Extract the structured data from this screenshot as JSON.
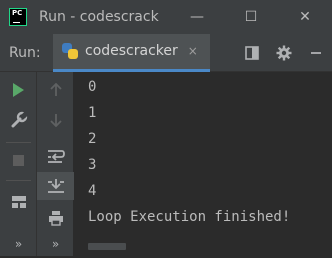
{
  "window": {
    "title": "Run - codescrack",
    "app_logo_text": "PC",
    "controls": {
      "minimize": "—",
      "maximize": "☐",
      "close": "✕"
    }
  },
  "run_toolbar": {
    "label": "Run:",
    "tab_label": "codescracker",
    "tab_close": "×",
    "settings_icon": "gear-icon",
    "layout_icon": "layout-icon",
    "minimize_icon": "minus-icon"
  },
  "console": {
    "lines": [
      "0",
      "1",
      "2",
      "3",
      "4",
      "Loop Execution finished!"
    ]
  },
  "side_actions": {
    "more_left": "»",
    "more_right": "»"
  },
  "colors": {
    "background": "#2b2b2b",
    "toolbar": "#3c3f41",
    "run_green": "#59a869",
    "tab_underline": "#4a88c7",
    "text": "#bbbbbb"
  }
}
